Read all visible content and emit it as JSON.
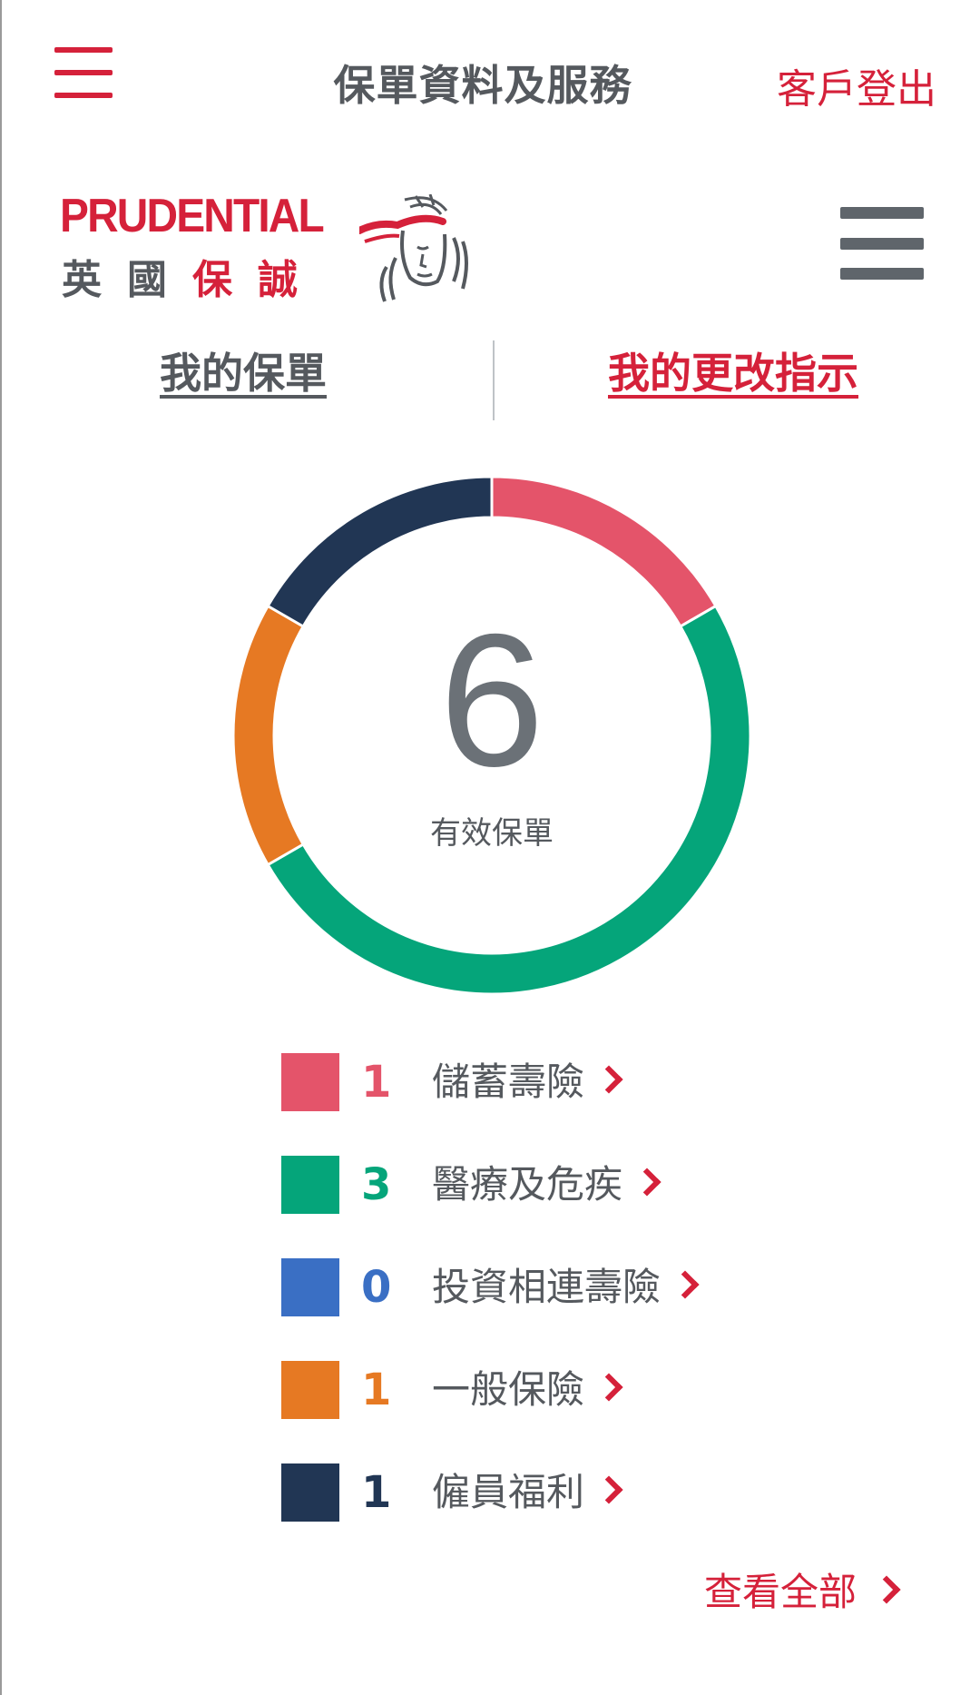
{
  "header": {
    "title": "保單資料及服務",
    "logout_label": "客戶登出",
    "accent_color": "#d5213a"
  },
  "brand": {
    "name": "PRUDENTIAL",
    "chinese_name_grey": "英國",
    "chinese_name_red": "保誠"
  },
  "tabs": [
    {
      "label": "我的保單",
      "active": false
    },
    {
      "label": "我的更改指示",
      "active": true
    }
  ],
  "summary": {
    "total": "6",
    "caption": "有效保單"
  },
  "chart_data": {
    "type": "pie",
    "variant": "donut",
    "total": 6,
    "categories": [
      "儲蓄壽險",
      "醫療及危疾",
      "投資相連壽險",
      "一般保險",
      "僱員福利"
    ],
    "values": [
      1,
      3,
      0,
      1,
      1
    ],
    "colors": [
      "#e4546a",
      "#05a57a",
      "#3a6fc4",
      "#e67923",
      "#213654"
    ]
  },
  "legend": [
    {
      "count": "1",
      "label": "儲蓄壽險",
      "color": "#e4546a"
    },
    {
      "count": "3",
      "label": "醫療及危疾",
      "color": "#05a57a"
    },
    {
      "count": "0",
      "label": "投資相連壽險",
      "color": "#3a6fc4"
    },
    {
      "count": "1",
      "label": "一般保險",
      "color": "#e67923"
    },
    {
      "count": "1",
      "label": "僱員福利",
      "color": "#213654"
    }
  ],
  "view_all_label": "查看全部"
}
